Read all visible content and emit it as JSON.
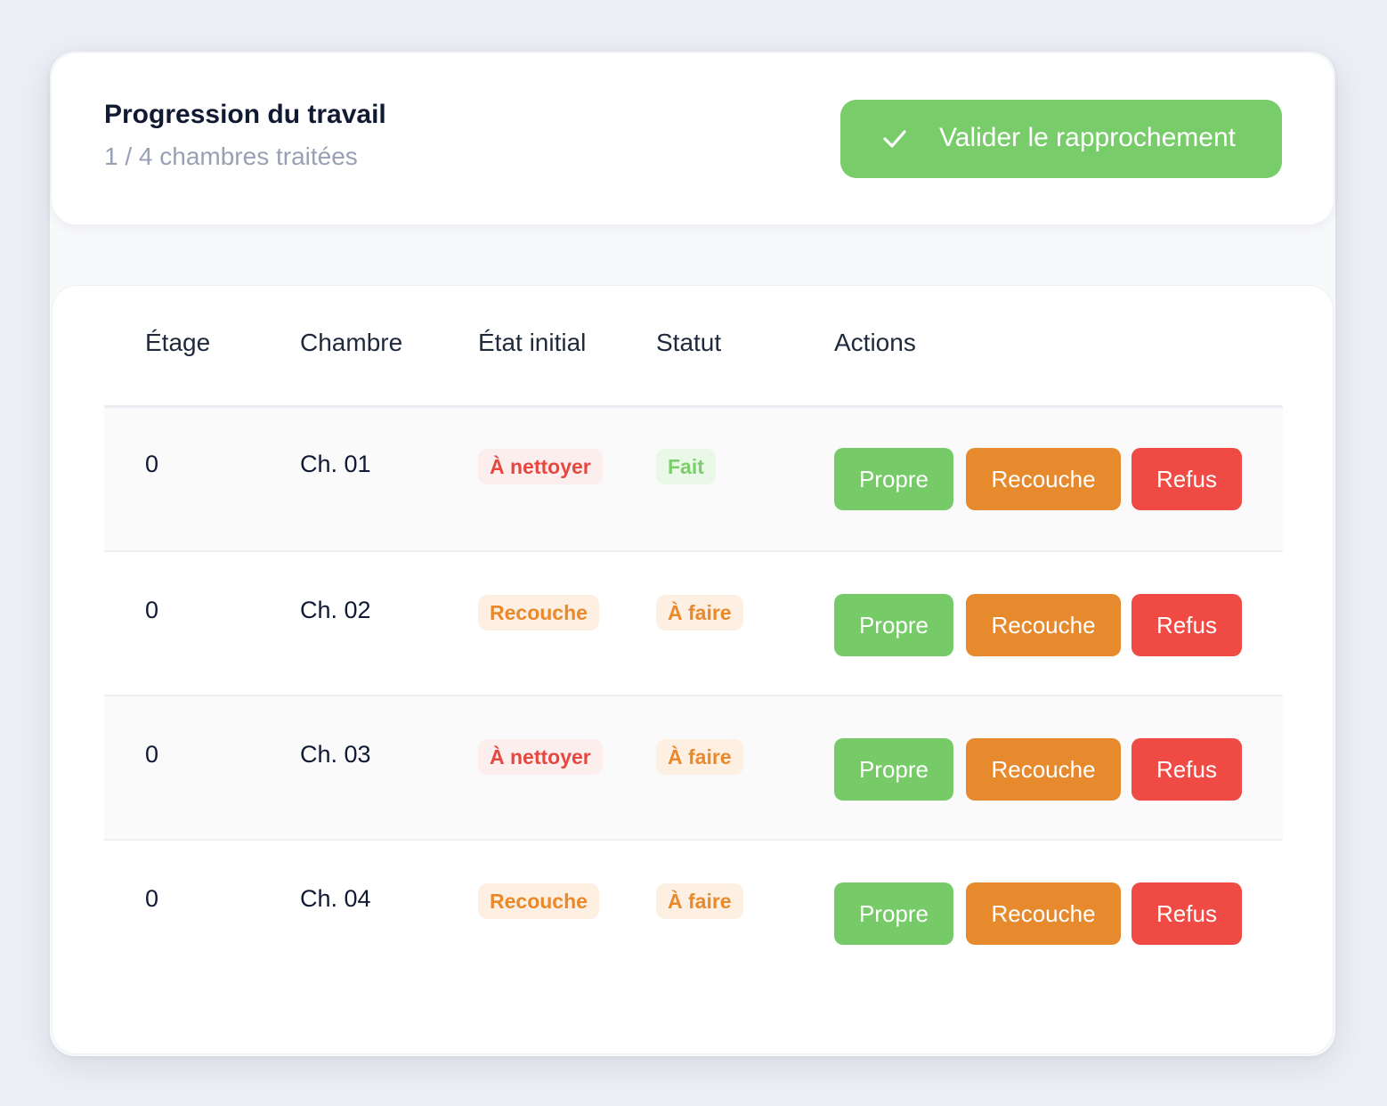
{
  "colors": {
    "page_background": "#eceff4",
    "accent_green": "#78cd6a",
    "accent_orange": "#e78a2d",
    "accent_red": "#ef4b44",
    "title_text": "#111a33",
    "muted_text": "#98a1b3"
  },
  "progress": {
    "title": "Progression du travail",
    "count_text": "1 / 4 chambres traitées",
    "done": 1,
    "total": 4
  },
  "validate_button": {
    "icon": "check-icon",
    "label": "Valider le rapprochement"
  },
  "table": {
    "headers": {
      "floor": "Étage",
      "room": "Chambre",
      "initial_state": "État initial",
      "status": "Statut",
      "actions": "Actions"
    },
    "action_labels": {
      "clean": "Propre",
      "recouche": "Recouche",
      "refus": "Refus"
    },
    "rows": [
      {
        "floor": "0",
        "room": "Ch. 01",
        "initial_state": "À nettoyer",
        "initial_state_color": "red",
        "status": "Fait",
        "status_color": "green"
      },
      {
        "floor": "0",
        "room": "Ch. 02",
        "initial_state": "Recouche",
        "initial_state_color": "orange",
        "status": "À faire",
        "status_color": "orange"
      },
      {
        "floor": "0",
        "room": "Ch. 03",
        "initial_state": "À nettoyer",
        "initial_state_color": "red",
        "status": "À faire",
        "status_color": "orange"
      },
      {
        "floor": "0",
        "room": "Ch. 04",
        "initial_state": "Recouche",
        "initial_state_color": "orange",
        "status": "À faire",
        "status_color": "orange"
      }
    ]
  }
}
